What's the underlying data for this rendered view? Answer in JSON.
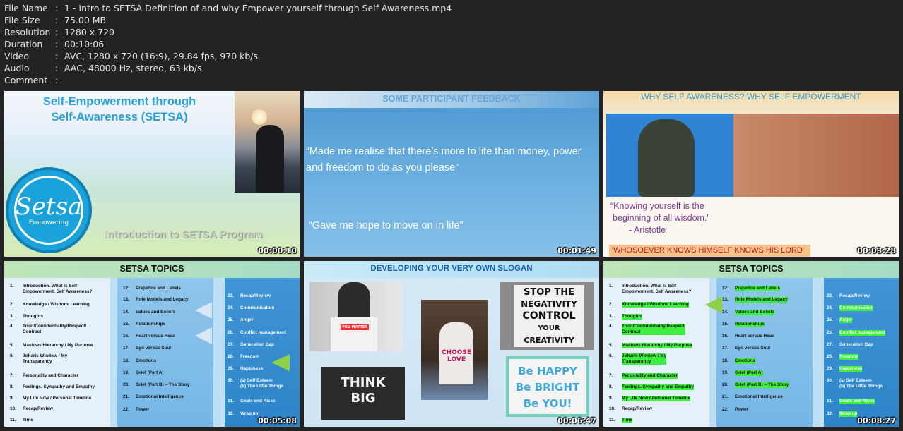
{
  "file_info": [
    {
      "key": "File Name",
      "value": "1 - Intro to SETSA Definition of and why Empower yourself through Self Awareness.mp4"
    },
    {
      "key": "File Size",
      "value": "75.00 MB"
    },
    {
      "key": "Resolution",
      "value": "1280 x 720"
    },
    {
      "key": "Duration",
      "value": "00:10:06"
    },
    {
      "key": "Video",
      "value": "AVC, 1280 x 720 (16:9), 29.84 fps, 970 kb/s"
    },
    {
      "key": "Audio",
      "value": "AAC, 48000 Hz, stereo, 63 kb/s"
    },
    {
      "key": "Comment",
      "value": ""
    }
  ],
  "separator": ":",
  "thumbnails": [
    {
      "timestamp": "00:00:10",
      "title": "Self-Empowerment through",
      "title2": "Self-Awareness (SETSA)",
      "logo_main": "Setsa",
      "logo_sub": "Empowering",
      "footer": "Introduction to SETSA Program"
    },
    {
      "timestamp": "00:01:49",
      "title": "SOME PARTICIPANT FEEDBACK",
      "quote1": "“Made me realise that there’s  more to life than money, power and  freedom to do as you please”",
      "quote2": "“Gave me hope to move on in life”"
    },
    {
      "timestamp": "00:03:28",
      "title": "WHY SELF AWARENESS? WHY SELF EMPOWERMENT",
      "quote_line1": "“Knowing yourself is the",
      "quote_line2": "beginning of all wisdom.”",
      "quote_author": "- Aristotle",
      "banner": "'WHOSOEVER KNOWS HIMSELF KNOWS HIS LORD'"
    },
    {
      "timestamp": "00:05:08",
      "title": "SETSA TOPICS"
    },
    {
      "timestamp": "00:06:47",
      "title": "DEVELOPING YOUR VERY OWN SLOGAN",
      "sign1": [
        "STOP THE",
        "NEGATIVITY",
        "CONTROL",
        "YOUR",
        "CREATIVITY"
      ],
      "sign2": "THINK BIG",
      "sign3": [
        "Be HAPPY",
        "Be BRIGHT",
        "Be YOU!"
      ],
      "shirt1": "YOU MATTER",
      "shirt2": "CHOOSE LOVE"
    },
    {
      "timestamp": "00:08:27",
      "title": "SETSA TOPICS"
    }
  ],
  "topics": {
    "col1": [
      {
        "n": "1.",
        "t": "Introduction. What is Self\nEmpowerment, Self Awareness?"
      },
      {
        "n": "2.",
        "t": "Knowledge / Wisdom/ Learning"
      },
      {
        "n": "3.",
        "t": "Thoughts"
      },
      {
        "n": "4.",
        "t": "Trust/Confidentiality/Respect/\nContract"
      },
      {
        "n": "5.",
        "t": "Maslows Hierarchy / My Purpose"
      },
      {
        "n": "6.",
        "t": "Joharis Window / My\nTransparency"
      },
      {
        "n": "7.",
        "t": "Personality and Character"
      },
      {
        "n": "8.",
        "t": "Feelings. Sympathy and Empathy"
      },
      {
        "n": "9.",
        "t": "My Life Now / Personal Timeline"
      },
      {
        "n": "10.",
        "t": "Recap/Review"
      },
      {
        "n": "11.",
        "t": "Time"
      }
    ],
    "col2": [
      {
        "n": "12.",
        "t": "Prejudice and Labels"
      },
      {
        "n": "13.",
        "t": "Role Models and Legacy"
      },
      {
        "n": "14.",
        "t": "Values and Beliefs"
      },
      {
        "n": "15.",
        "t": "Relationships"
      },
      {
        "n": "16.",
        "t": "Heart versus Head"
      },
      {
        "n": "17.",
        "t": "Ego versus Soul"
      },
      {
        "n": "18.",
        "t": "Emotions"
      },
      {
        "n": "19.",
        "t": "Grief (Part A)"
      },
      {
        "n": "20.",
        "t": "Grief (Part B) – The Story"
      },
      {
        "n": "21.",
        "t": "Emotional Intelligence"
      },
      {
        "n": "22.",
        "t": "Power"
      }
    ],
    "col3": [
      {
        "n": "23.",
        "t": "Recap/Review"
      },
      {
        "n": "24.",
        "t": "Communication"
      },
      {
        "n": "25.",
        "t": "Anger"
      },
      {
        "n": "26.",
        "t": "Conflict management"
      },
      {
        "n": "27.",
        "t": "Generation Gap"
      },
      {
        "n": "28.",
        "t": "Freedom"
      },
      {
        "n": "29.",
        "t": "Happiness"
      },
      {
        "n": "30.",
        "t": "(a) Self Esteem\n(b) The Little Things"
      },
      {
        "n": "31.",
        "t": "Goals and Risks"
      },
      {
        "n": "32.",
        "t": "Wrap up"
      }
    ]
  },
  "colors": {
    "background": "#232323",
    "text": "#e6e6e6",
    "highlight": "#3ef03e",
    "accent_blue": "#2ba1d6"
  }
}
